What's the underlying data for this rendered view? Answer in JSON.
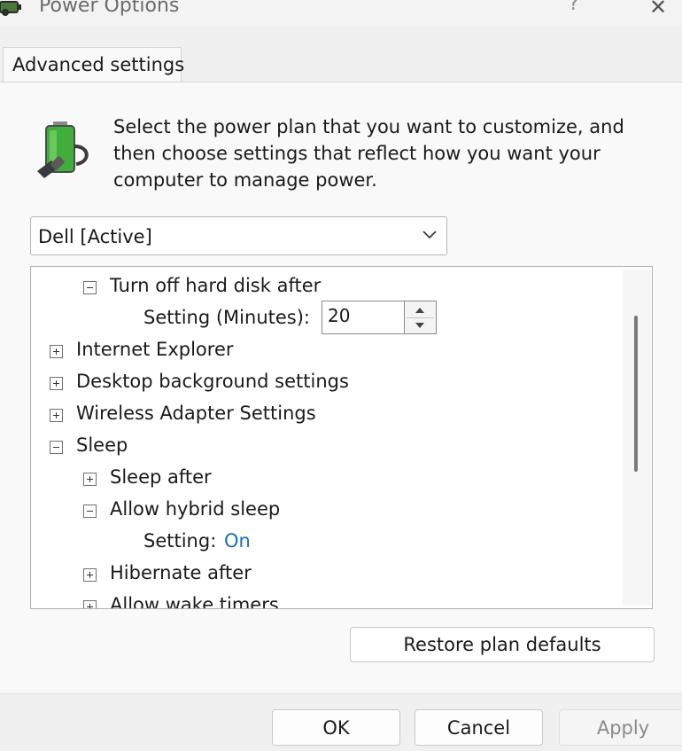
{
  "window": {
    "title": "Power Options",
    "help_label": "?",
    "close_label": "✕"
  },
  "tabs": [
    {
      "label": "Advanced settings",
      "active": true
    }
  ],
  "intro_text": "Select the power plan that you want to customize, and then choose settings that reflect how you want your computer to manage power.",
  "plan_select": {
    "value": "Dell [Active]"
  },
  "tree": {
    "items": [
      {
        "label": "Turn off hard disk after",
        "state": "expanded",
        "level": 1
      },
      {
        "label": "Setting (Minutes):",
        "value": "20",
        "type": "spinner",
        "level": 2
      },
      {
        "label": "Internet Explorer",
        "state": "collapsed",
        "level": 0
      },
      {
        "label": "Desktop background settings",
        "state": "collapsed",
        "level": 0
      },
      {
        "label": "Wireless Adapter Settings",
        "state": "collapsed",
        "level": 0
      },
      {
        "label": "Sleep",
        "state": "expanded",
        "level": 0
      },
      {
        "label": "Sleep after",
        "state": "collapsed",
        "level": 1
      },
      {
        "label": "Allow hybrid sleep",
        "state": "expanded",
        "level": 1
      },
      {
        "label": "Setting:",
        "value": "On",
        "level": 2
      },
      {
        "label": "Hibernate after",
        "state": "collapsed",
        "level": 1
      },
      {
        "label": "Allow wake timers",
        "state": "collapsed",
        "level": 1
      }
    ]
  },
  "buttons": {
    "restore": "Restore plan defaults",
    "ok": "OK",
    "cancel": "Cancel",
    "apply": "Apply"
  },
  "colors": {
    "value_link": "#1a6fb5",
    "battery_green": "#3fae3a"
  }
}
